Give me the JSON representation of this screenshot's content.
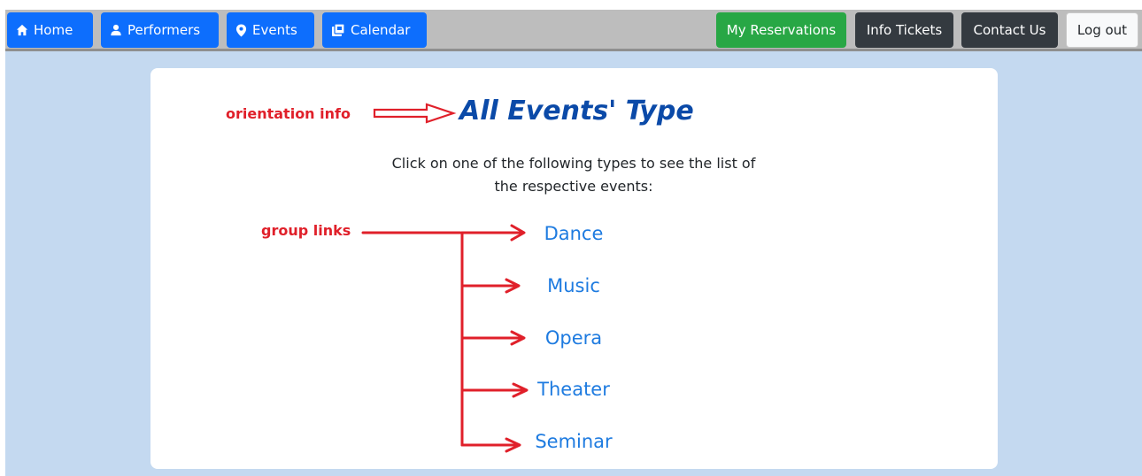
{
  "navbar": {
    "left_buttons": [
      {
        "label": "Home",
        "icon": "home-icon"
      },
      {
        "label": "Performers",
        "icon": "person-icon"
      },
      {
        "label": "Events",
        "icon": "map-pin-icon"
      },
      {
        "label": "Calendar",
        "icon": "calendar-icon"
      }
    ],
    "right_buttons": [
      {
        "label": "My Reservations"
      },
      {
        "label": "Info Tickets"
      },
      {
        "label": "Contact Us"
      },
      {
        "label": "Log out"
      }
    ]
  },
  "main": {
    "title": "All Events' Type",
    "instruction_line1": "Click on one of the following types to see the list of",
    "instruction_line2": "the respective events:",
    "event_types": [
      "Dance",
      "Music",
      "Opera",
      "Theater",
      "Seminar"
    ]
  },
  "annotations": {
    "orientation_label": "orientation info",
    "group_label": "group links"
  },
  "colors": {
    "nav_primary": "#0d6efd",
    "nav_success": "#28a745",
    "nav_dark": "#343a40",
    "page_background": "#c4d9f0",
    "title": "#0b4aa8",
    "link": "#1e7be0",
    "annotation": "#e0202a"
  }
}
